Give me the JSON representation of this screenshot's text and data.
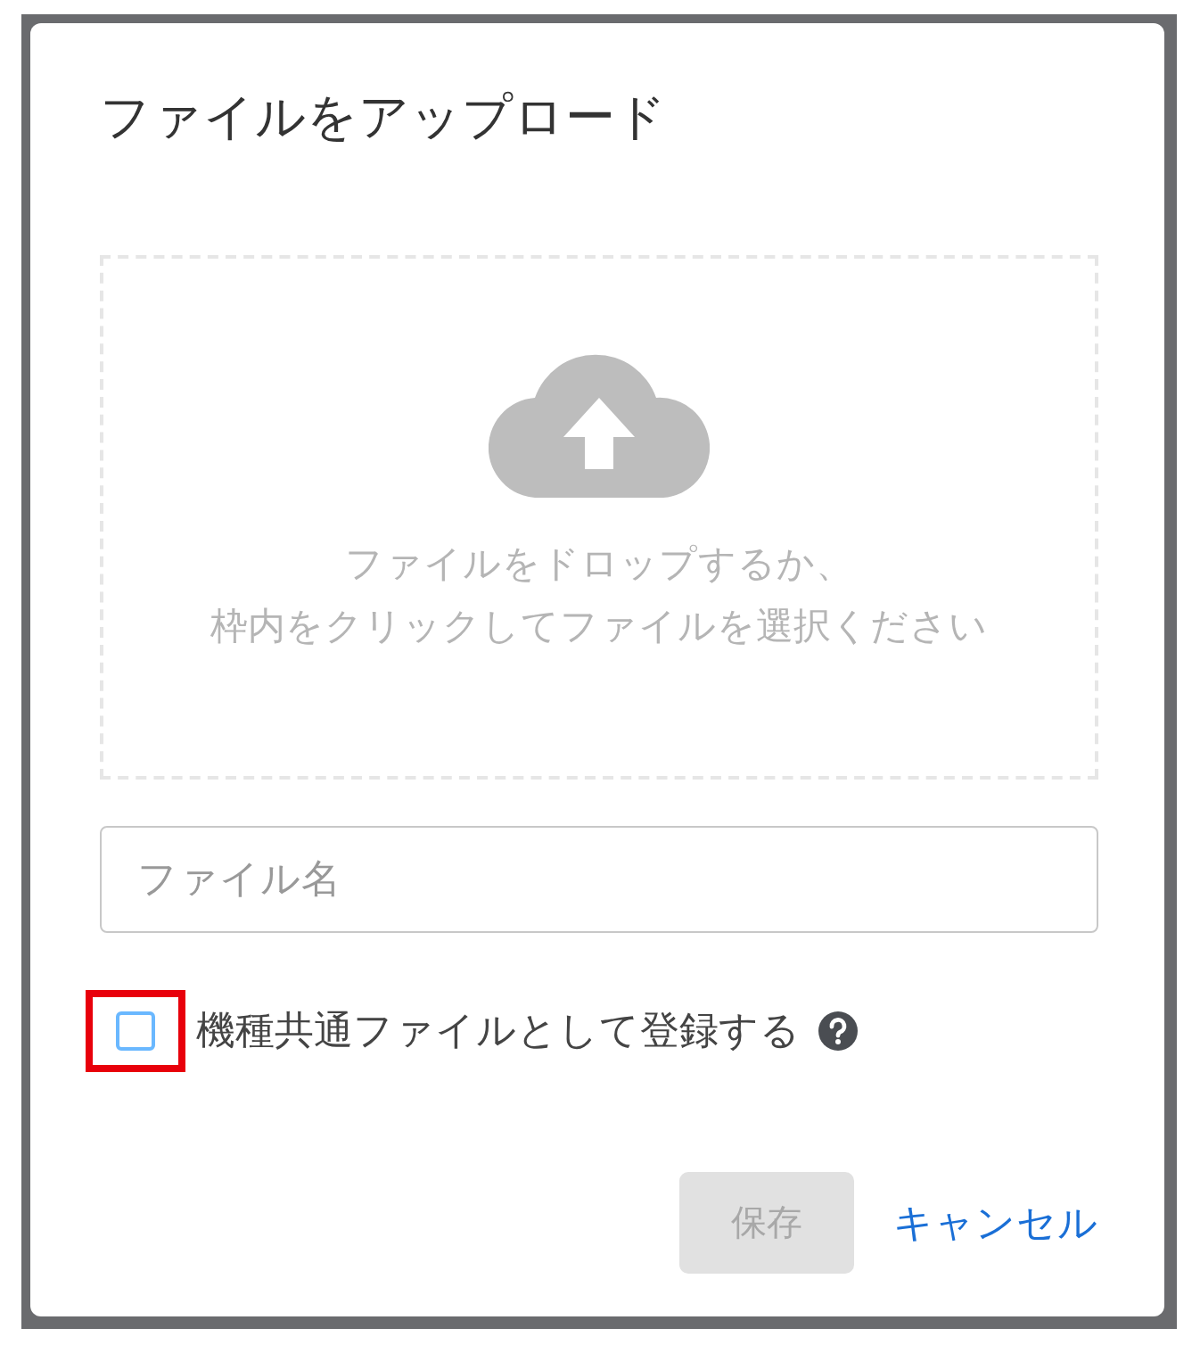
{
  "dialog": {
    "title": "ファイルをアップロード"
  },
  "dropzone": {
    "lines": [
      "ファイルをドロップするか、",
      "枠内をクリックしてファイルを選択ください"
    ]
  },
  "filename_field": {
    "placeholder": "ファイル名"
  },
  "common_file_checkbox": {
    "label": "機種共通ファイルとして登録する",
    "checked": false,
    "highlighted": true
  },
  "buttons": [
    {
      "kind": "primary",
      "label": "保存",
      "disabled": true
    },
    {
      "kind": "link",
      "label": "キャンセル",
      "disabled": false
    }
  ]
}
